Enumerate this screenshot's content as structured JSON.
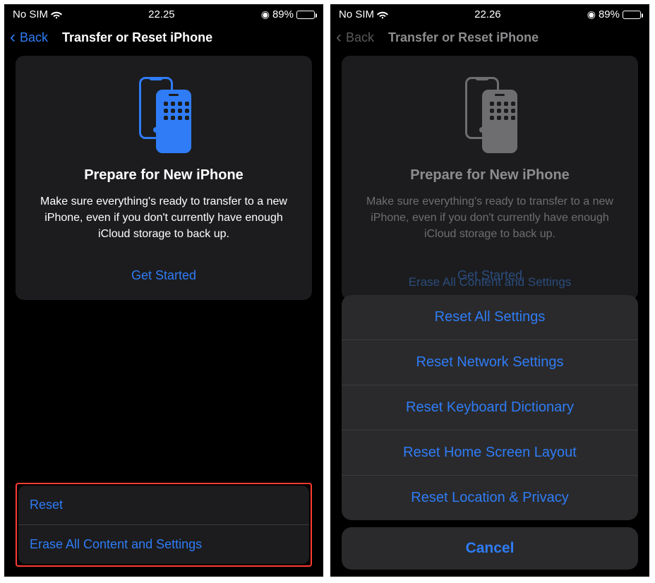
{
  "left": {
    "status": {
      "carrier": "No SIM",
      "time": "22.25",
      "battery_pct": "89%"
    },
    "nav": {
      "back": "Back",
      "title": "Transfer or Reset iPhone"
    },
    "card": {
      "title": "Prepare for New iPhone",
      "desc": "Make sure everything's ready to transfer to a new iPhone, even if you don't currently have enough iCloud storage to back up.",
      "cta": "Get Started"
    },
    "bottom": {
      "reset": "Reset",
      "erase": "Erase All Content and Settings"
    },
    "illus_color": "#2f7cf6"
  },
  "right": {
    "status": {
      "carrier": "No SIM",
      "time": "22.26",
      "battery_pct": "89%"
    },
    "nav": {
      "back": "Back",
      "title": "Transfer or Reset iPhone"
    },
    "card": {
      "title": "Prepare for New iPhone",
      "desc": "Make sure everything's ready to transfer to a new iPhone, even if you don't currently have enough iCloud storage to back up.",
      "cta": "Get Started"
    },
    "behind_row": "Erase All Content and Settings",
    "sheet": {
      "items": {
        "0": "Reset All Settings",
        "1": "Reset Network Settings",
        "2": "Reset Keyboard Dictionary",
        "3": "Reset Home Screen Layout",
        "4": "Reset Location & Privacy"
      },
      "cancel": "Cancel"
    },
    "illus_color": "#6e6e70"
  }
}
